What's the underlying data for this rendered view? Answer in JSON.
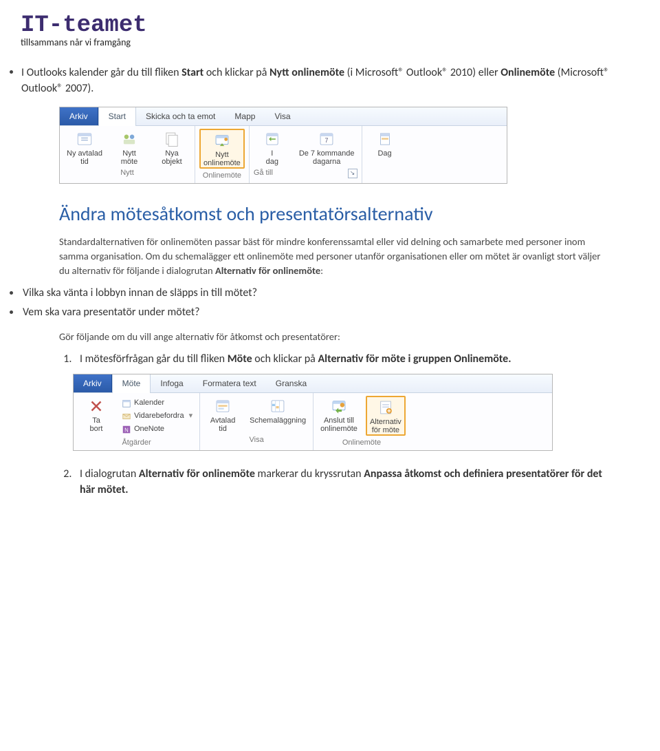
{
  "logo": {
    "text": "IT-teamet",
    "tagline": "tillsammans når vi framgång"
  },
  "intro": {
    "pre": "I Outlooks kalender går du till fliken ",
    "b1": "Start",
    "mid1": " och klickar på ",
    "b2": "Nytt onlinemöte",
    "mid2": " (i Microsoft® Outlook® 2010) eller ",
    "b3": "Onlinemöte",
    "post": " (Microsoft® Outlook® 2007)."
  },
  "ribbon1": {
    "tabs": {
      "file": "Arkiv",
      "start": "Start",
      "send": "Skicka och ta emot",
      "map": "Mapp",
      "view": "Visa"
    },
    "nytt": {
      "ny_avtalad": "Ny avtalad\ntid",
      "nytt_mote": "Nytt\nmöte",
      "nya_objekt": "Nya\nobjekt",
      "label": "Nytt"
    },
    "online": {
      "nytt_onlinemote": "Nytt\nonlinemöte",
      "label": "Onlinemöte"
    },
    "goto": {
      "i_dag": "I\ndag",
      "de7": "De 7 kommande\ndagarna",
      "label": "Gå till"
    },
    "dag": "Dag"
  },
  "section_title": "Ändra mötesåtkomst och presentatörsalternativ",
  "para1": "Standardalternativen för onlinemöten passar bäst för mindre konferenssamtal eller vid delning och samarbete med personer inom samma organisation. Om du schemalägger ett onlinemöte med personer utanför organisationen eller om mötet är ovanligt stort väljer du alternativ för följande i dialogrutan ",
  "para1_b": "Alternativ för onlinemöte",
  "bullets": {
    "b1": "Vilka ska vänta i lobbyn innan de släpps in till mötet?",
    "b2": "Vem ska vara presentatör under mötet?"
  },
  "para2": "Gör följande om du vill ange alternativ för åtkomst och presentatörer:",
  "step1": {
    "pre": "I mötesförfrågan går du till fliken ",
    "b1": "Möte",
    "mid": " och klickar på ",
    "b2": "Alternativ för möte i gruppen Onlinemöte."
  },
  "ribbon2": {
    "tabs": {
      "file": "Arkiv",
      "mote": "Möte",
      "infoga": "Infoga",
      "format": "Formatera text",
      "granska": "Granska"
    },
    "atgarder": {
      "ta_bort": "Ta\nbort",
      "kalender": "Kalender",
      "vidare": "Vidarebefordra",
      "onenote": "OneNote",
      "label": "Åtgärder"
    },
    "visa": {
      "avtalad": "Avtalad\ntid",
      "schema": "Schemaläggning",
      "label": "Visa"
    },
    "online": {
      "anslut": "Anslut till\nonlinemöte",
      "alternativ": "Alternativ\nför möte",
      "label": "Onlinemöte"
    }
  },
  "step2": {
    "pre": "I dialogrutan ",
    "b1": "Alternativ för onlinemöte",
    "mid": " markerar du kryssrutan ",
    "b2": "Anpassa åtkomst och definiera presentatörer för det här mötet."
  }
}
